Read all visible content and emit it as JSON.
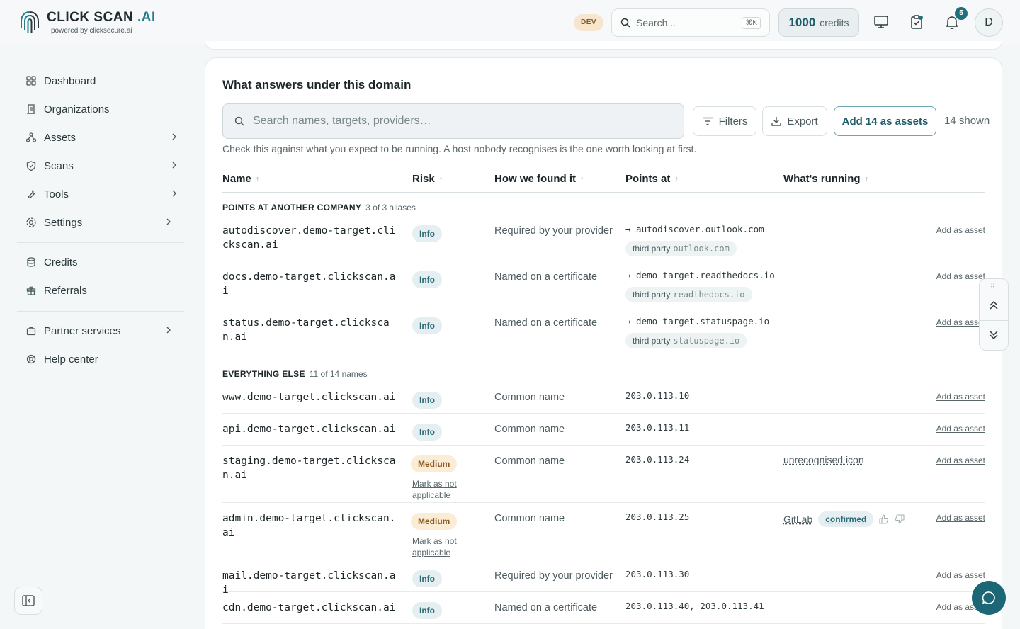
{
  "app": {
    "title_main": "CLICK SCAN",
    "title_accent": ".AI",
    "subtitle": "powered by clicksecure.ai",
    "env_badge": "DEV"
  },
  "topbar": {
    "search_placeholder": "Search...",
    "search_shortcut": "⌘K",
    "credits_value": "1000",
    "credits_label": "credits",
    "notifications_count": "5",
    "avatar_initial": "D",
    "icons": [
      "monitor-icon",
      "clipboard-check-icon",
      "bell-icon"
    ]
  },
  "sidebar": {
    "items": [
      {
        "label": "Dashboard",
        "icon": "grid-icon",
        "chevron": false
      },
      {
        "label": "Organizations",
        "icon": "building-icon",
        "chevron": false
      },
      {
        "label": "Assets",
        "icon": "nodes-icon",
        "chevron": true
      },
      {
        "label": "Scans",
        "icon": "shield-icon",
        "chevron": true
      },
      {
        "label": "Tools",
        "icon": "wrench-icon",
        "chevron": true
      },
      {
        "label": "Settings",
        "icon": "gear-icon",
        "chevron": true
      },
      {
        "label": "Credits",
        "icon": "database-icon",
        "chevron": false
      },
      {
        "label": "Referrals",
        "icon": "gift-icon",
        "chevron": false
      },
      {
        "label": "Partner services",
        "icon": "briefcase-icon",
        "chevron": true
      },
      {
        "label": "Help center",
        "icon": "lifebuoy-icon",
        "chevron": false
      }
    ]
  },
  "main": {
    "title": "What answers under this domain",
    "search_placeholder": "Search names, targets, providers…",
    "filters_label": "Filters",
    "export_label": "Export",
    "add_all_label": "Add 14 as assets",
    "shown_label": "14 shown",
    "hint": "Check this against what you expect to be running. A host nobody recognises is the one worth looking at first.",
    "columns": [
      "Name",
      "Risk",
      "How we found it",
      "Points at",
      "What's running"
    ],
    "groups": [
      {
        "title": "POINTS AT ANOTHER COMPANY",
        "sub": "3 of 3 aliases"
      },
      {
        "title": "EVERYTHING ELSE",
        "sub": "11 of 14 names"
      }
    ],
    "rows": [
      {
        "name": "autodiscover.demo-target.clickscan.ai",
        "risk": "Info",
        "how": "Required by your provider",
        "points": "→ autodiscover.outlook.com",
        "tp_label": "third party",
        "tp_domain": "outlook.com",
        "add": "Add as asset"
      },
      {
        "name": "docs.demo-target.clickscan.ai",
        "risk": "Info",
        "how": "Named on a certificate",
        "points": "→ demo-target.readthedocs.io",
        "tp_label": "third party",
        "tp_domain": "readthedocs.io",
        "add": "Add as asset"
      },
      {
        "name": "status.demo-target.clickscan.ai",
        "risk": "Info",
        "how": "Named on a certificate",
        "points": "→ demo-target.statuspage.io",
        "tp_label": "third party",
        "tp_domain": "statuspage.io",
        "add": "Add as asset"
      },
      {
        "name": "www.demo-target.clickscan.ai",
        "risk": "Info",
        "how": "Common name",
        "points": "203.0.113.10",
        "add": "Add as asset"
      },
      {
        "name": "api.demo-target.clickscan.ai",
        "risk": "Info",
        "how": "Common name",
        "points": "203.0.113.11",
        "add": "Add as asset"
      },
      {
        "name": "staging.demo-target.clickscan.ai",
        "risk": "Medium",
        "mark": "Mark as not applicable",
        "how": "Common name",
        "points": "203.0.113.24",
        "running": "unrecognised icon",
        "add": "Add as asset"
      },
      {
        "name": "admin.demo-target.clickscan.ai",
        "risk": "Medium",
        "mark": "Mark as not applicable",
        "how": "Common name",
        "points": "203.0.113.25",
        "running": "GitLab",
        "running_status": "confirmed",
        "add": "Add as asset"
      },
      {
        "name": "mail.demo-target.clickscan.ai",
        "risk": "Info",
        "how": "Required by your provider",
        "points": "203.0.113.30",
        "add": "Add as asset"
      },
      {
        "name": "cdn.demo-target.clickscan.ai",
        "risk": "Info",
        "how": "Named on a certificate",
        "points": "203.0.113.40, 203.0.113.41",
        "add": "Add as asset"
      }
    ]
  },
  "colors": {
    "accent": "#1f7c8c",
    "info_badge_bg": "#e5eff1",
    "medium_badge_bg": "#fbecd6",
    "chat_button": "#1d6676"
  }
}
